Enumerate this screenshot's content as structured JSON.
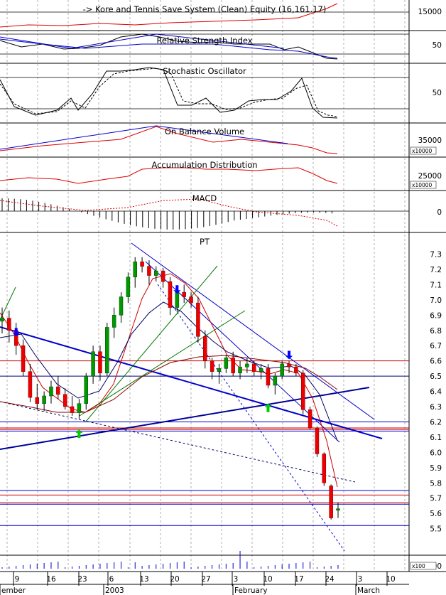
{
  "chart_data": {
    "type": "candlestick",
    "panels": [
      {
        "id": "equity",
        "title": "-> Kore and Tennis Save System (Clean) Equity (16,161.17)",
        "ticks": [
          "15000"
        ],
        "multiplier": ""
      },
      {
        "id": "rsi",
        "title": "Relative Strength Index",
        "ticks": [
          "50"
        ],
        "multiplier": ""
      },
      {
        "id": "stochastic",
        "title": "Stochastic Oscillator",
        "ticks": [
          "50"
        ],
        "multiplier": ""
      },
      {
        "id": "obv",
        "title": "On Balance Volume",
        "ticks": [
          "35000"
        ],
        "multiplier": "x10000"
      },
      {
        "id": "ad",
        "title": "Accumulation Distribution",
        "ticks": [
          "25000"
        ],
        "multiplier": "x10000"
      },
      {
        "id": "macd",
        "title": "MACD",
        "ticks": [
          "0"
        ],
        "multiplier": ""
      },
      {
        "id": "price",
        "title": "PT",
        "ticks": [
          "7.3",
          "7.2",
          "7.1",
          "7.0",
          "6.9",
          "6.8",
          "6.7",
          "6.6",
          "6.5",
          "6.4",
          "6.3",
          "6.2",
          "6.1",
          "6.0",
          "5.9",
          "5.8",
          "5.7",
          "5.6",
          "5.5"
        ],
        "multiplier": ""
      },
      {
        "id": "volume",
        "title": "",
        "ticks": [
          "000"
        ],
        "multiplier": "x100"
      }
    ],
    "price_ylim": [
      5.42,
      7.4
    ],
    "x_day_labels": [
      "9",
      "16",
      "23",
      "6",
      "13",
      "20",
      "27",
      "3",
      "10",
      "17",
      "24",
      "3",
      "10"
    ],
    "x_month_labels": [
      "ember",
      "2003",
      "February",
      "March"
    ],
    "candles": [
      {
        "o": 6.86,
        "h": 6.95,
        "l": 6.78,
        "c": 6.88
      },
      {
        "o": 6.88,
        "h": 6.93,
        "l": 6.72,
        "c": 6.8
      },
      {
        "o": 6.8,
        "h": 6.85,
        "l": 6.64,
        "c": 6.7
      },
      {
        "o": 6.7,
        "h": 6.74,
        "l": 6.5,
        "c": 6.53
      },
      {
        "o": 6.53,
        "h": 6.58,
        "l": 6.33,
        "c": 6.36
      },
      {
        "o": 6.36,
        "h": 6.45,
        "l": 6.28,
        "c": 6.32
      },
      {
        "o": 6.32,
        "h": 6.4,
        "l": 6.27,
        "c": 6.37
      },
      {
        "o": 6.37,
        "h": 6.47,
        "l": 6.32,
        "c": 6.43
      },
      {
        "o": 6.43,
        "h": 6.5,
        "l": 6.35,
        "c": 6.38
      },
      {
        "o": 6.38,
        "h": 6.42,
        "l": 6.28,
        "c": 6.3
      },
      {
        "o": 6.3,
        "h": 6.37,
        "l": 6.24,
        "c": 6.26
      },
      {
        "o": 6.26,
        "h": 6.35,
        "l": 6.22,
        "c": 6.32
      },
      {
        "o": 6.32,
        "h": 6.52,
        "l": 6.28,
        "c": 6.5
      },
      {
        "o": 6.5,
        "h": 6.7,
        "l": 6.45,
        "c": 6.66
      },
      {
        "o": 6.66,
        "h": 6.7,
        "l": 6.47,
        "c": 6.52
      },
      {
        "o": 6.52,
        "h": 6.85,
        "l": 6.5,
        "c": 6.82
      },
      {
        "o": 6.82,
        "h": 6.95,
        "l": 6.75,
        "c": 6.9
      },
      {
        "o": 6.9,
        "h": 7.05,
        "l": 6.85,
        "c": 7.02
      },
      {
        "o": 7.02,
        "h": 7.18,
        "l": 6.98,
        "c": 7.15
      },
      {
        "o": 7.15,
        "h": 7.28,
        "l": 7.08,
        "c": 7.25
      },
      {
        "o": 7.25,
        "h": 7.28,
        "l": 7.18,
        "c": 7.22
      },
      {
        "o": 7.22,
        "h": 7.26,
        "l": 7.1,
        "c": 7.16
      },
      {
        "o": 7.16,
        "h": 7.22,
        "l": 7.12,
        "c": 7.19
      },
      {
        "o": 7.19,
        "h": 7.21,
        "l": 7.08,
        "c": 7.12
      },
      {
        "o": 7.12,
        "h": 7.15,
        "l": 6.9,
        "c": 6.95
      },
      {
        "o": 6.95,
        "h": 7.08,
        "l": 6.92,
        "c": 7.05
      },
      {
        "o": 7.05,
        "h": 7.1,
        "l": 6.98,
        "c": 7.02
      },
      {
        "o": 7.02,
        "h": 7.05,
        "l": 6.95,
        "c": 6.98
      },
      {
        "o": 6.98,
        "h": 7.02,
        "l": 6.72,
        "c": 6.76
      },
      {
        "o": 6.76,
        "h": 6.8,
        "l": 6.55,
        "c": 6.6
      },
      {
        "o": 6.6,
        "h": 6.62,
        "l": 6.48,
        "c": 6.53
      },
      {
        "o": 6.53,
        "h": 6.58,
        "l": 6.45,
        "c": 6.55
      },
      {
        "o": 6.55,
        "h": 6.64,
        "l": 6.52,
        "c": 6.62
      },
      {
        "o": 6.62,
        "h": 6.66,
        "l": 6.5,
        "c": 6.52
      },
      {
        "o": 6.52,
        "h": 6.6,
        "l": 6.48,
        "c": 6.56
      },
      {
        "o": 6.56,
        "h": 6.62,
        "l": 6.52,
        "c": 6.58
      },
      {
        "o": 6.58,
        "h": 6.6,
        "l": 6.5,
        "c": 6.53
      },
      {
        "o": 6.53,
        "h": 6.58,
        "l": 6.48,
        "c": 6.55
      },
      {
        "o": 6.55,
        "h": 6.58,
        "l": 6.42,
        "c": 6.44
      },
      {
        "o": 6.44,
        "h": 6.52,
        "l": 6.38,
        "c": 6.5
      },
      {
        "o": 6.5,
        "h": 6.6,
        "l": 6.48,
        "c": 6.58
      },
      {
        "o": 6.58,
        "h": 6.6,
        "l": 6.52,
        "c": 6.56
      },
      {
        "o": 6.56,
        "h": 6.58,
        "l": 6.5,
        "c": 6.52
      },
      {
        "o": 6.52,
        "h": 6.54,
        "l": 6.25,
        "c": 6.28
      },
      {
        "o": 6.28,
        "h": 6.3,
        "l": 6.15,
        "c": 6.16
      },
      {
        "o": 6.16,
        "h": 6.17,
        "l": 5.97,
        "c": 5.99
      },
      {
        "o": 5.99,
        "h": 6.0,
        "l": 5.78,
        "c": 5.8
      },
      {
        "o": 5.78,
        "h": 5.79,
        "l": 5.56,
        "c": 5.57
      },
      {
        "o": 5.62,
        "h": 5.67,
        "l": 5.57,
        "c": 5.63
      }
    ],
    "signals": [
      {
        "type": "sell",
        "bar": 2,
        "price": 6.76
      },
      {
        "type": "buy",
        "bar": 11,
        "price": 6.15
      },
      {
        "type": "sell",
        "bar": 25,
        "price": 7.04
      },
      {
        "type": "buy",
        "bar": 38,
        "price": 6.32
      },
      {
        "type": "sell",
        "bar": 41,
        "price": 6.61
      }
    ],
    "horizontal_levels": [
      {
        "price": 6.6,
        "color": "#cc0000"
      },
      {
        "price": 6.5,
        "color": "#000080"
      },
      {
        "price": 6.2,
        "color": "#0000cc"
      },
      {
        "price": 6.16,
        "color": "#cc0000"
      },
      {
        "price": 6.15,
        "color": "#cc0000"
      },
      {
        "price": 6.14,
        "color": "#0000cc"
      },
      {
        "price": 5.75,
        "color": "#0000cc"
      },
      {
        "price": 5.72,
        "color": "#cc0000"
      },
      {
        "price": 5.67,
        "color": "#cc0000"
      },
      {
        "price": 5.66,
        "color": "#0000cc"
      },
      {
        "price": 5.52,
        "color": "#0000cc"
      }
    ],
    "colors": {
      "up": "#009900",
      "down": "#ee0000",
      "trend_blue": "#0000cc",
      "trend_green": "#007700",
      "ma_red": "#cc0000",
      "ma_navy": "#000066"
    }
  }
}
